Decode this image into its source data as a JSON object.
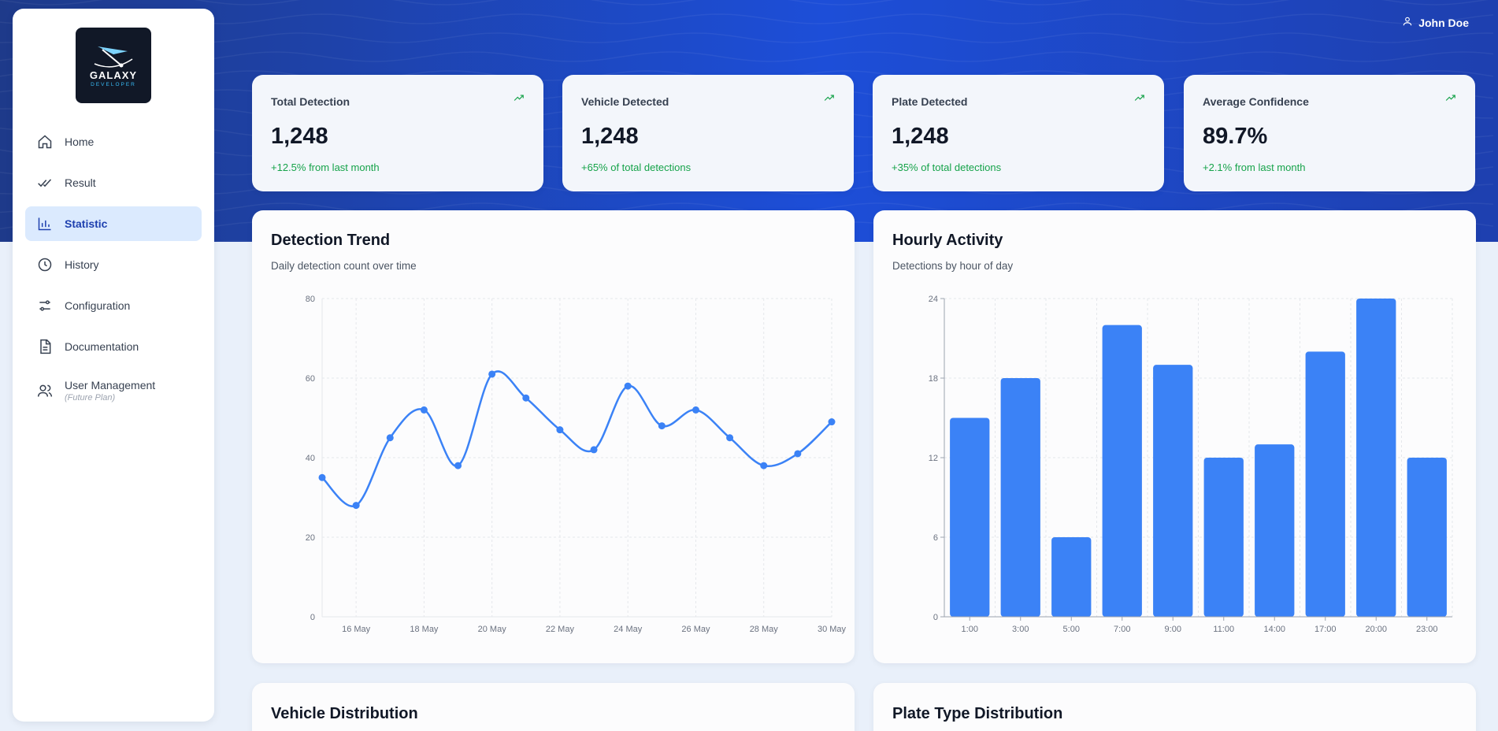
{
  "user": {
    "name": "John Doe",
    "icon": "user-icon"
  },
  "logo": {
    "title": "GALAXY",
    "subtitle": "DEVELOPER"
  },
  "sidebar": {
    "items": [
      {
        "label": "Home",
        "icon": "home-icon"
      },
      {
        "label": "Result",
        "icon": "check-double-icon"
      },
      {
        "label": "Statistic",
        "icon": "bar-chart-icon",
        "active": true
      },
      {
        "label": "History",
        "icon": "clock-icon"
      },
      {
        "label": "Configuration",
        "icon": "sliders-icon"
      },
      {
        "label": "Documentation",
        "icon": "document-icon"
      },
      {
        "label": "User Management",
        "sublabel": "(Future Plan)",
        "icon": "users-icon"
      }
    ]
  },
  "stats": [
    {
      "title": "Total Detection",
      "value": "1,248",
      "change": "+12.5% from last month"
    },
    {
      "title": "Vehicle Detected",
      "value": "1,248",
      "change": "+65% of total detections"
    },
    {
      "title": "Plate Detected",
      "value": "1,248",
      "change": "+35% of total detections"
    },
    {
      "title": "Average Confidence",
      "value": "89.7%",
      "change": "+2.1% from last month"
    }
  ],
  "colors": {
    "accent": "#3b82f6",
    "positive": "#16a34a",
    "hero": "#1e40af"
  },
  "panels": {
    "trend": {
      "title": "Detection Trend",
      "subtitle": "Daily detection count over time"
    },
    "hourly": {
      "title": "Hourly Activity",
      "subtitle": "Detections by hour of day"
    },
    "vehicle": {
      "title": "Vehicle Distribution"
    },
    "plate": {
      "title": "Plate Type Distribution"
    }
  },
  "chart_data": [
    {
      "type": "line",
      "title": "Detection Trend",
      "x": [
        "15 May",
        "16 May",
        "17 May",
        "18 May",
        "19 May",
        "20 May",
        "21 May",
        "22 May",
        "23 May",
        "24 May",
        "25 May",
        "26 May",
        "27 May",
        "28 May",
        "29 May",
        "30 May"
      ],
      "x_tick_labels": [
        "16 May",
        "18 May",
        "20 May",
        "22 May",
        "24 May",
        "26 May",
        "28 May",
        "30 May"
      ],
      "values": [
        35,
        28,
        45,
        52,
        38,
        61,
        55,
        47,
        42,
        58,
        48,
        52,
        45,
        38,
        41,
        49
      ],
      "ylim": [
        0,
        80
      ],
      "y_ticks": [
        0,
        20,
        40,
        60,
        80
      ],
      "grid": true,
      "color": "#3b82f6"
    },
    {
      "type": "bar",
      "title": "Hourly Activity",
      "categories": [
        "1:00",
        "3:00",
        "5:00",
        "7:00",
        "9:00",
        "11:00",
        "14:00",
        "17:00",
        "20:00",
        "23:00"
      ],
      "values": [
        15,
        18,
        6,
        22,
        19,
        12,
        13,
        20,
        24,
        12
      ],
      "ylim": [
        0,
        24
      ],
      "y_ticks": [
        0,
        6,
        12,
        18,
        24
      ],
      "grid": true,
      "color": "#3b82f6"
    }
  ]
}
